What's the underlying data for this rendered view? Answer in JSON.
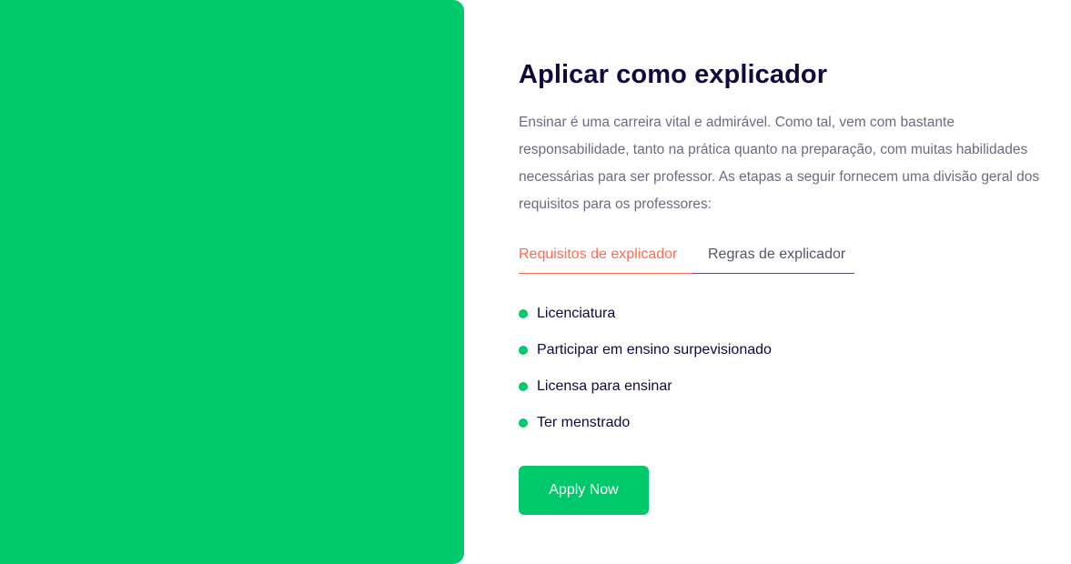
{
  "colors": {
    "brand_green": "#00c96b",
    "title": "#0f0a3c",
    "body_text": "#6b6b80",
    "tab_active": "#ff6a52",
    "tab_inactive": "#55556a"
  },
  "section": {
    "title": "Aplicar como explicador",
    "description": "Ensinar é uma carreira vital e admirável. Como tal, vem com bastante responsabilidade, tanto na prática quanto na preparação, com muitas habilidades necessárias para ser professor. As etapas a seguir fornecem uma divisão geral dos requisitos para os professores:"
  },
  "tabs": [
    {
      "label": "Requisitos de explicador",
      "active": true
    },
    {
      "label": "Regras de explicador",
      "active": false
    }
  ],
  "requirements": [
    {
      "label": "Licenciatura"
    },
    {
      "label": "Participar em ensino surpevisionado"
    },
    {
      "label": "Licensa para ensinar"
    },
    {
      "label": "Ter menstrado"
    }
  ],
  "apply_button": {
    "label": "Apply Now"
  }
}
